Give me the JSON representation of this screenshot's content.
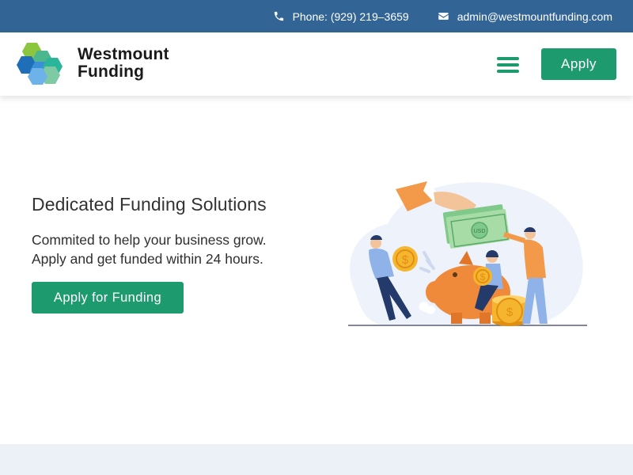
{
  "topbar": {
    "phone": {
      "icon": "phone-icon",
      "text": "Phone: (929) 219–3659"
    },
    "email": {
      "icon": "envelope-icon",
      "text": "admin@westmountfunding.com"
    },
    "background": "#326596"
  },
  "header": {
    "logo": {
      "icon": "hexagon-logo",
      "line1": "Westmount",
      "line2": "Funding"
    },
    "menu_icon": "hamburger-menu-icon",
    "apply_label": "Apply"
  },
  "hero": {
    "title": "Dedicated Funding Solutions",
    "subtitle_line1": "Commited to help your business grow.",
    "subtitle_line2": "Apply and get funded within 24 hours.",
    "cta_label": "Apply for Funding",
    "illustration": "money-piggy-bank-illustration",
    "banknote_label": "USD"
  },
  "colors": {
    "accent": "#1e9b6e",
    "topbar": "#326596",
    "band": "#ecf1f8",
    "coin": "#f6b52e"
  }
}
